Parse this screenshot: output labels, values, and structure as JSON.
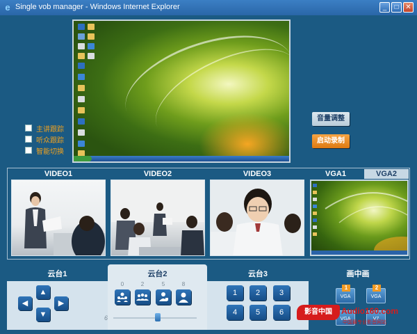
{
  "window": {
    "title": "Single vob manager - Windows Internet Explorer",
    "minimize": "_",
    "maximize": "□",
    "close": "✕",
    "icon": "ie-icon"
  },
  "options": [
    {
      "label": "主讲跟踪"
    },
    {
      "label": "听众跟踪"
    },
    {
      "label": "智能切换"
    }
  ],
  "buttons": {
    "volume": "音量调整",
    "record": "启动录制"
  },
  "videos": [
    {
      "label": "VIDEO1"
    },
    {
      "label": "VIDEO2"
    },
    {
      "label": "VIDEO3"
    }
  ],
  "vga_tabs": [
    "VGA1",
    "VGA2"
  ],
  "ptz": {
    "tab1": "云台1",
    "tab2": "云台2",
    "tab3": "云台3",
    "pip": "画中画",
    "arrows": [
      "▲",
      "◀",
      "▶",
      "▼"
    ],
    "preset_labels": [
      "0",
      "2",
      "5",
      "8"
    ],
    "slider_value": "6",
    "slider_level": 0.53,
    "numbers": [
      "1",
      "2",
      "3",
      "4",
      "5",
      "6"
    ]
  },
  "pip_buttons": [
    {
      "badge": "1",
      "text": "VGA"
    },
    {
      "badge": "2",
      "text": "VGA"
    },
    {
      "badge": "",
      "text": "VGA"
    },
    {
      "badge": "",
      "text": "V7"
    }
  ],
  "watermark": {
    "logo": "影音中国",
    "url": "Audio160.com",
    "sub": "中国最专业影音网站"
  },
  "colors": {
    "background": "#1b5a83",
    "accent_orange": "#f1a21f",
    "button_blue": "#2f74b8"
  }
}
